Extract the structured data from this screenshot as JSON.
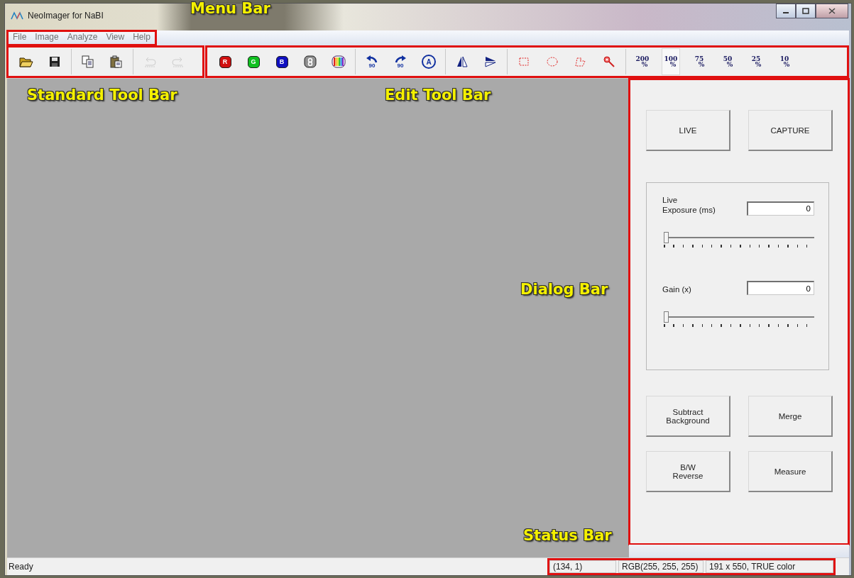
{
  "window": {
    "title": "NeoImager for NaBI"
  },
  "menu_bar": {
    "highlighted": true,
    "items": [
      {
        "label": "File"
      },
      {
        "label": "Image"
      },
      {
        "label": "Analyze"
      },
      {
        "label": "View"
      },
      {
        "label": "Help"
      }
    ]
  },
  "standard_toolbar": {
    "highlighted": true,
    "groups": [
      [
        {
          "kind": "open",
          "disabled": false
        },
        {
          "kind": "save",
          "disabled": false
        }
      ],
      [
        {
          "kind": "copy",
          "disabled": false
        },
        {
          "kind": "paste",
          "disabled": false
        }
      ],
      [
        {
          "kind": "undo",
          "disabled": true
        },
        {
          "kind": "redo",
          "disabled": true
        }
      ]
    ]
  },
  "edit_toolbar": {
    "highlighted": true,
    "groups": [
      [
        {
          "kind": "channel",
          "label": "R",
          "color": "#d01010"
        },
        {
          "kind": "channel",
          "label": "G",
          "color": "#10c020"
        },
        {
          "kind": "channel",
          "label": "B",
          "color": "#1010c0"
        },
        {
          "kind": "gray"
        },
        {
          "kind": "rainbow"
        }
      ],
      [
        {
          "kind": "rotate_left",
          "label": "90"
        },
        {
          "kind": "rotate_right",
          "label": "90"
        },
        {
          "kind": "auto",
          "label": "A"
        }
      ],
      [
        {
          "kind": "flip_h"
        },
        {
          "kind": "flip_v"
        }
      ],
      [
        {
          "kind": "rect_select"
        },
        {
          "kind": "ellipse_select"
        },
        {
          "kind": "free_select"
        },
        {
          "kind": "magic_select"
        }
      ],
      [
        {
          "kind": "zoom",
          "label": "200",
          "unit": "%",
          "selected": false
        },
        {
          "kind": "zoom",
          "label": "100",
          "unit": "%",
          "selected": true
        },
        {
          "kind": "zoom",
          "label": "75",
          "unit": "%",
          "selected": false
        },
        {
          "kind": "zoom",
          "label": "50",
          "unit": "%",
          "selected": false
        },
        {
          "kind": "zoom",
          "label": "25",
          "unit": "%",
          "selected": false
        },
        {
          "kind": "zoom",
          "label": "10",
          "unit": "%",
          "selected": false
        }
      ]
    ]
  },
  "dialog": {
    "highlighted": true,
    "top_buttons": [
      "LIVE",
      "CAPTURE"
    ],
    "controls": [
      {
        "label": "Live\nExposure (ms)",
        "value": "0",
        "level": 0
      },
      {
        "label": "Gain (x)",
        "value": "0",
        "level": 0
      }
    ],
    "bottom_buttons": [
      "Subtract\nBackground",
      "Merge",
      "B/W\nReverse",
      "Measure"
    ]
  },
  "status_bar": {
    "highlighted": true,
    "message": "Ready",
    "panes": [
      "(134, 1)",
      "RGB(255, 255, 255)",
      "191 x 550, TRUE color"
    ]
  },
  "annotations": [
    {
      "text": "Menu Bar"
    },
    {
      "text": "Standard Tool Bar"
    },
    {
      "text": "Edit Tool Bar"
    },
    {
      "text": "Dialog Bar"
    },
    {
      "text": "Status Bar"
    }
  ]
}
